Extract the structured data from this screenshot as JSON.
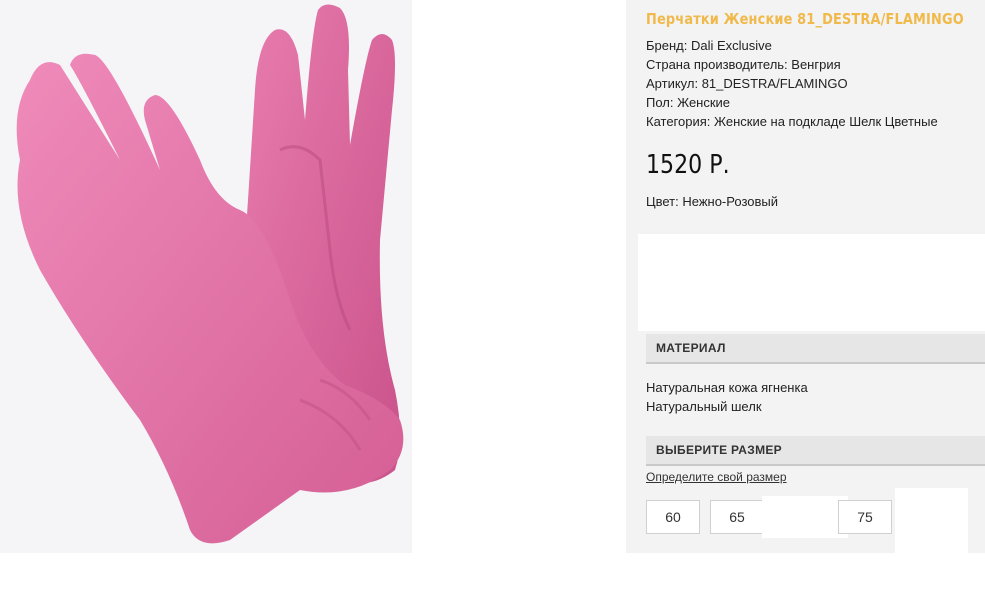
{
  "product": {
    "title": "Перчатки Женские 81_DESTRA/FLAMINGO",
    "specs": [
      "Бренд: Dali Exclusive",
      "Страна производитель: Венгрия",
      "Артикул: 81_DESTRA/FLAMINGO",
      "Пол: Женские",
      "Категория: Женские на подкладе Шелк Цветные"
    ],
    "price": "1520 Р.",
    "color": "Цвет: Нежно-Розовый"
  },
  "material": {
    "heading": "МАТЕРИАЛ",
    "items": [
      "Натуральная кожа ягненка",
      "Натуральный шелк"
    ]
  },
  "size": {
    "heading": "ВЫБЕРИТЕ РАЗМЕР",
    "link": "Определите свой размер",
    "options": [
      "60",
      "65",
      "75"
    ]
  },
  "colors": {
    "title_accent": "#f0b94a",
    "glove_pink": "#e16fa1",
    "panel_bg": "#f3f3f3"
  }
}
